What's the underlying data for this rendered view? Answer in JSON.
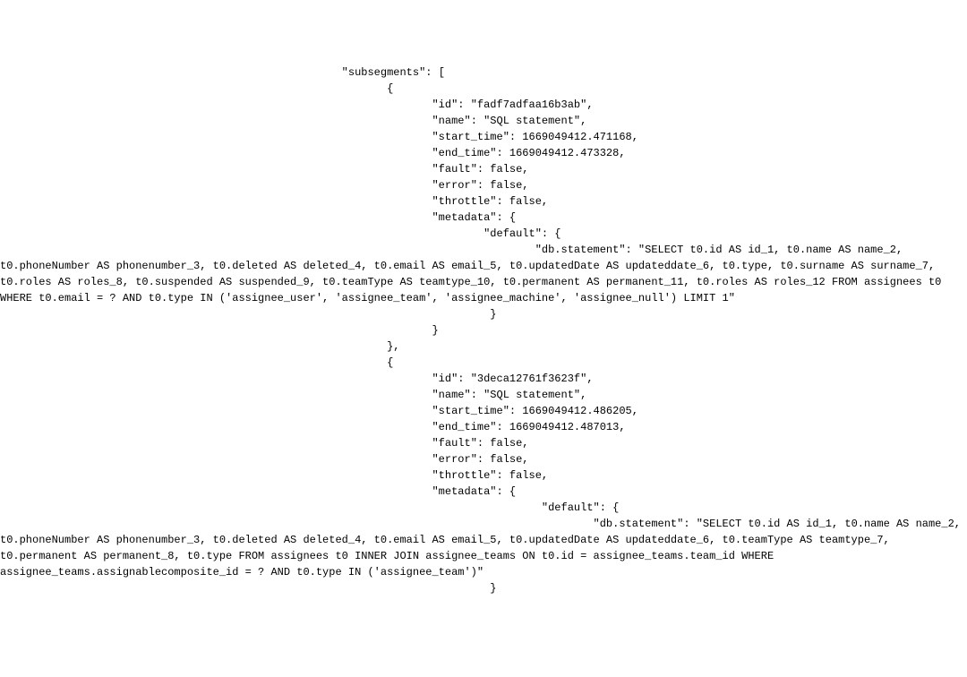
{
  "snippet": {
    "key_subsegments": "\"subsegments\": [",
    "item1": {
      "id_line": "\"id\": \"fadf7adfaa16b3ab\",",
      "name_line": "\"name\": \"SQL statement\",",
      "start_time_line": "\"start_time\": 1669049412.471168,",
      "end_time_line": "\"end_time\": 1669049412.473328,",
      "fault_line": "\"fault\": false,",
      "error_line": "\"error\": false,",
      "throttle_line": "\"throttle\": false,",
      "metadata_line": "\"metadata\": {",
      "default_line": "\"default\": {",
      "db_statement": "\"db.statement\": \"SELECT t0.id AS id_1, t0.name AS name_2, t0.phoneNumber AS phonenumber_3, t0.deleted AS deleted_4, t0.email AS email_5, t0.updatedDate AS updateddate_6, t0.type, t0.surname AS surname_7, t0.roles AS roles_8, t0.suspended AS suspended_9, t0.teamType AS teamtype_10, t0.permanent AS permanent_11, t0.roles AS roles_12 FROM assignees t0 WHERE t0.email = ? AND t0.type IN ('assignee_user', 'assignee_team', 'assignee_machine', 'assignee_null') LIMIT 1\""
    },
    "item2": {
      "id_line": "\"id\": \"3deca12761f3623f\",",
      "name_line": "\"name\": \"SQL statement\",",
      "start_time_line": "\"start_time\": 1669049412.486205,",
      "end_time_line": "\"end_time\": 1669049412.487013,",
      "fault_line": "\"fault\": false,",
      "error_line": "\"error\": false,",
      "throttle_line": "\"throttle\": false,",
      "metadata_line": "\"metadata\": {",
      "default_line": "\"default\": {",
      "db_statement": "\"db.statement\": \"SELECT t0.id AS id_1, t0.name AS name_2, t0.phoneNumber AS phonenumber_3, t0.deleted AS deleted_4, t0.email AS email_5, t0.updatedDate AS updateddate_6, t0.teamType AS teamtype_7, t0.permanent AS permanent_8, t0.type FROM assignees t0 INNER JOIN assignee_teams ON t0.id = assignee_teams.team_id WHERE assignee_teams.assignablecomposite_id = ? AND t0.type IN ('assignee_team')\""
    },
    "indent": {
      "lvl0": "",
      "subseg_key": "                                                     ",
      "obj_open": "                                                            {",
      "obj_close_comma": "                                                            },",
      "field": "                                                                   ",
      "metadata_open": "                                                                   ",
      "default_indent_open": "                                                                           ",
      "default_indent_open2": "                                                                                    ",
      "dbstmt_indent": "                                                                                   ",
      "close_brace1": "                                                                            }",
      "close_brace2": "                                                                   }",
      "close_brace3": "                                                                            }"
    }
  }
}
